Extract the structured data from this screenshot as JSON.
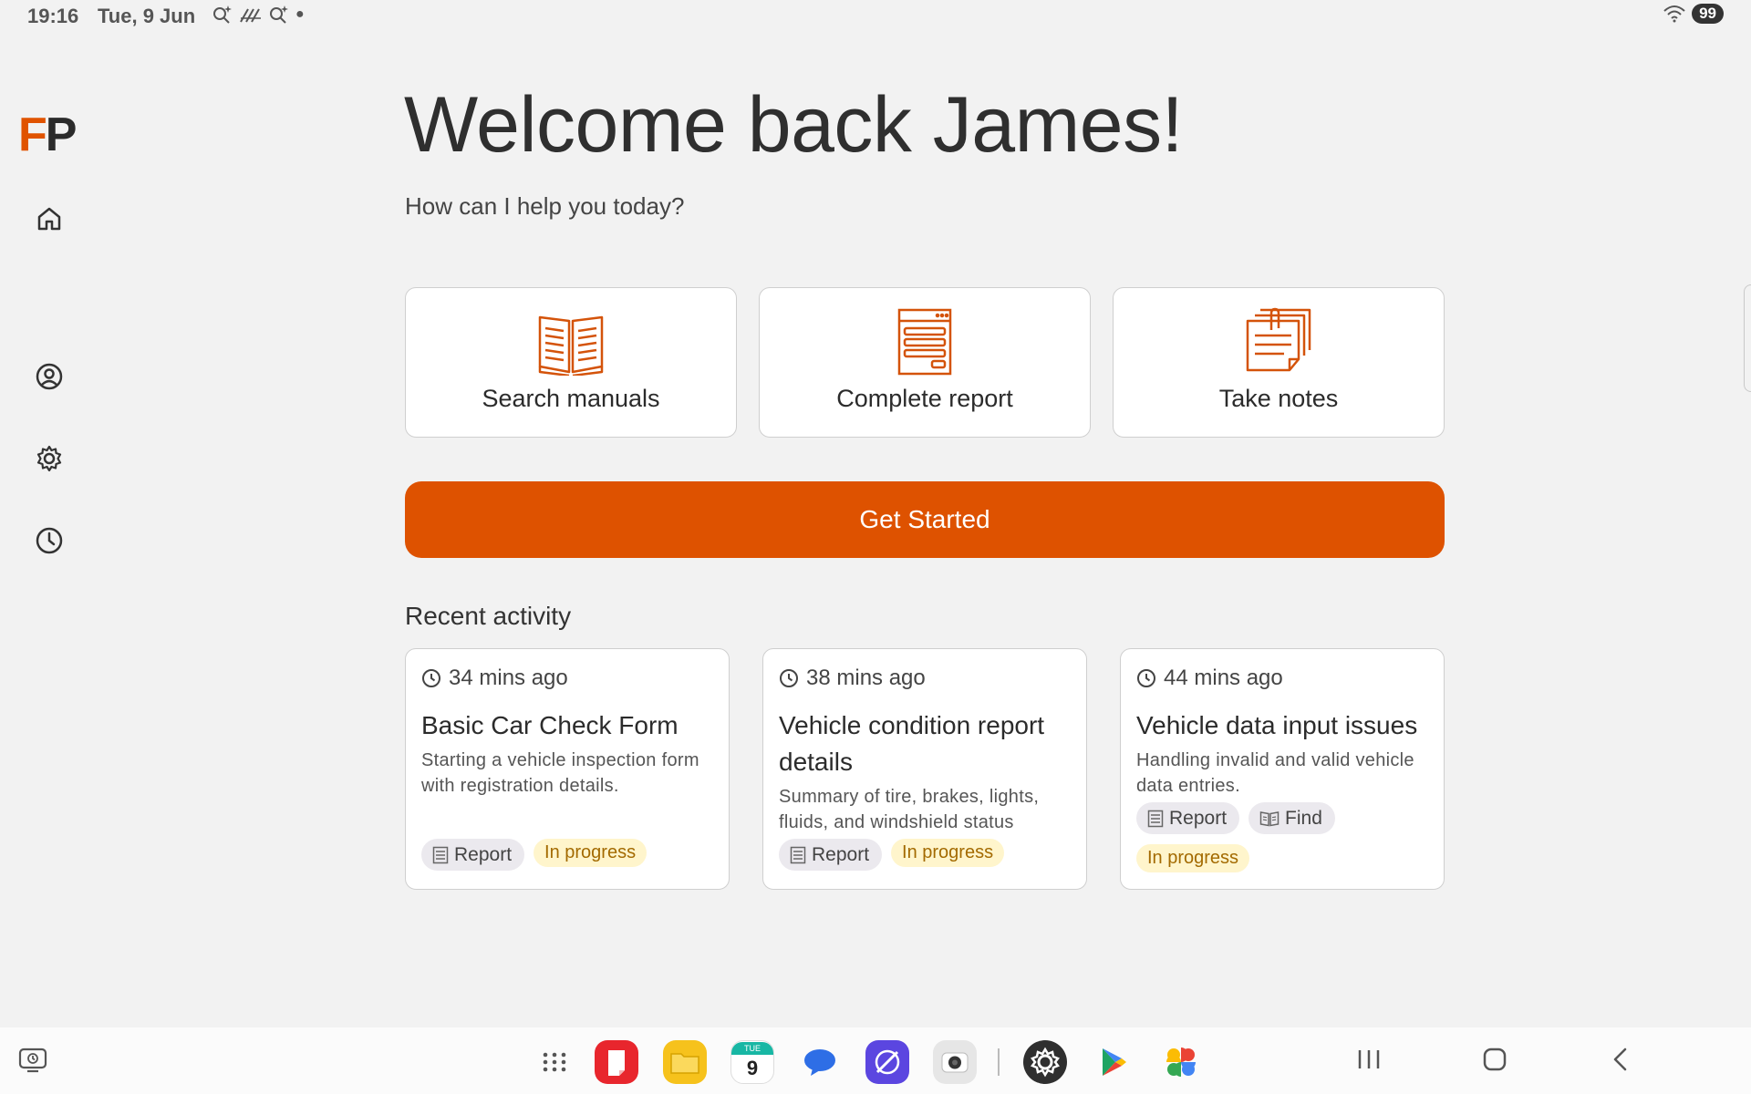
{
  "status_bar": {
    "time": "19:16",
    "date": "Tue, 9 Jun",
    "battery": "99"
  },
  "app": {
    "logo_f": "F",
    "logo_p": "P",
    "accent_color": "#de5200"
  },
  "sidebar": {
    "items": [
      {
        "name": "home",
        "icon": "home-icon"
      },
      {
        "name": "profile",
        "icon": "user-circle-icon"
      },
      {
        "name": "settings",
        "icon": "gear-icon"
      },
      {
        "name": "history",
        "icon": "clock-icon"
      }
    ]
  },
  "header": {
    "title": "Welcome back James!",
    "subtitle": "How can I help you today?"
  },
  "actions": [
    {
      "label": "Search manuals",
      "icon": "open-book-icon"
    },
    {
      "label": "Complete report",
      "icon": "report-form-icon"
    },
    {
      "label": "Take notes",
      "icon": "notes-clip-icon"
    }
  ],
  "cta": {
    "label": "Get Started"
  },
  "recent": {
    "heading": "Recent activity",
    "items": [
      {
        "time": "34 mins ago",
        "title": "Basic Car Check Form",
        "description": "Starting a vehicle inspection form with registration details.",
        "tags": [
          "Report"
        ],
        "status": "In progress"
      },
      {
        "time": "38 mins ago",
        "title": "Vehicle condition report details",
        "description": "Summary of tire, brakes, lights, fluids, and windshield status",
        "tags": [
          "Report"
        ],
        "status": "In progress"
      },
      {
        "time": "44 mins ago",
        "title": "Vehicle data input issues",
        "description": "Handling invalid and valid vehicle data entries.",
        "tags": [
          "Report",
          "Find"
        ],
        "status": "In progress"
      }
    ]
  },
  "taskbar": {
    "calendar_day_label": "TUE",
    "calendar_day": "9",
    "apps": [
      "app-drawer-icon",
      "notes-app-icon",
      "files-app-icon",
      "calendar-app-icon",
      "messages-app-icon",
      "browser-app-icon",
      "camera-app-icon",
      "settings-app-icon",
      "play-store-icon",
      "photos-app-icon"
    ]
  }
}
